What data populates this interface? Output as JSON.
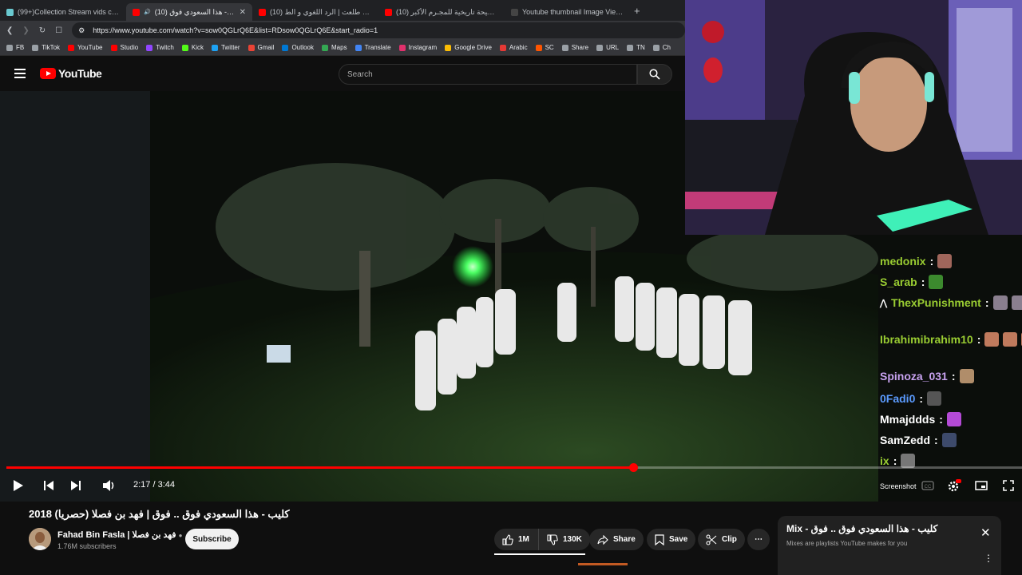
{
  "browser": {
    "tabs": [
      {
        "title": "(99+)Collection Stream vids created",
        "color": "#69c9d0",
        "active": false
      },
      {
        "title": "كليب - هذا السعودي فوق (10)",
        "color": "#ff0000",
        "active": true
      },
      {
        "title": "(10) د. هيثم طلعت | الرد اللغوي و الط...",
        "color": "#ff0000",
        "active": false
      },
      {
        "title": "(10) فضيحة تاريخية للمجـرم الأكبر - ...",
        "color": "#ff0000",
        "active": false
      },
      {
        "title": "Youtube thumbnail Image View and",
        "color": "#444444",
        "active": false
      }
    ],
    "new_tab": "+",
    "url": "https://www.youtube.com/watch?v=sow0QGLrQ6E&list=RDsow0QGLrQ6E&start_radio=1",
    "bookmarks": [
      {
        "label": "FB",
        "color": "#9aa0a6"
      },
      {
        "label": "TikTok",
        "color": "#9aa0a6"
      },
      {
        "label": "YouTube",
        "color": "#ff0000"
      },
      {
        "label": "Studio",
        "color": "#ff0000"
      },
      {
        "label": "Twitch",
        "color": "#9146ff"
      },
      {
        "label": "Kick",
        "color": "#53fc18"
      },
      {
        "label": "Twitter",
        "color": "#1da1f2"
      },
      {
        "label": "Gmail",
        "color": "#ea4335"
      },
      {
        "label": "Outlook",
        "color": "#0078d4"
      },
      {
        "label": "Maps",
        "color": "#34a853"
      },
      {
        "label": "Translate",
        "color": "#4285f4"
      },
      {
        "label": "Instagram",
        "color": "#e1306c"
      },
      {
        "label": "Google Drive",
        "color": "#fbbc04"
      },
      {
        "label": "Arabic",
        "color": "#e53935"
      },
      {
        "label": "SC",
        "color": "#ff5500"
      },
      {
        "label": "Share",
        "color": "#9aa0a6"
      },
      {
        "label": "URL",
        "color": "#9aa0a6"
      },
      {
        "label": "TN",
        "color": "#9aa0a6"
      },
      {
        "label": "Ch",
        "color": "#9aa0a6"
      }
    ]
  },
  "header": {
    "logo": "YouTube",
    "search_placeholder": "Search"
  },
  "player": {
    "progress": 0.6171,
    "time": "2:17 / 3:44",
    "screenshot_label": "Screenshot",
    "settings_badge_color": "#ff0000"
  },
  "chat": [
    {
      "user": "medonix",
      "color": "#9acd32",
      "emotes": [
        "#a0665b"
      ]
    },
    {
      "user": "S_arab",
      "color": "#9acd32",
      "emotes": [
        "#3c8a2e"
      ]
    },
    {
      "user": "ThexPunishment",
      "color": "#9acd32",
      "emotes": [
        "#8a7f8f",
        "#8a7f8f"
      ],
      "prefix": "⋀"
    },
    {
      "user": "Ibrahimibrahim10",
      "color": "#9acd32",
      "emotes": [
        "#c07a5d",
        "#c07a5d",
        "#c07a5d",
        "#c07a5d"
      ]
    },
    {
      "user": "Spinoza_031",
      "color": "#c8a2f0",
      "emotes": [
        "#b08d6a"
      ]
    },
    {
      "user": "0Fadi0",
      "color": "#5b9bff",
      "emotes": [
        "#555555"
      ]
    },
    {
      "user": "Mmajddds",
      "color": "#ffffff",
      "emotes": [
        "#b44ad6"
      ]
    },
    {
      "user": "SamZedd",
      "color": "#ffffff",
      "emotes": [
        "#3d4a6b"
      ]
    },
    {
      "user": "ix",
      "color": "#9acd32",
      "emotes": [
        "#777777"
      ]
    }
  ],
  "video": {
    "title": "كليب - هذا السعودي فوق .. فوق | فهد بن فصلا (حصريا) 2018",
    "channel": "Fahad Bin Fasla | فهد بن فصلا",
    "subscribers": "1.76M subscribers",
    "subscribe_label": "Subscribe",
    "likes": "1M",
    "dislikes": "130K",
    "share_label": "Share",
    "save_label": "Save",
    "clip_label": "Clip",
    "more_label": "⋯"
  },
  "mix": {
    "title": "Mix - كليب - هذا السعودي فوق .. فوق",
    "subtitle": "Mixes are playlists YouTube makes for you",
    "close": "✕",
    "more": "⋮"
  }
}
